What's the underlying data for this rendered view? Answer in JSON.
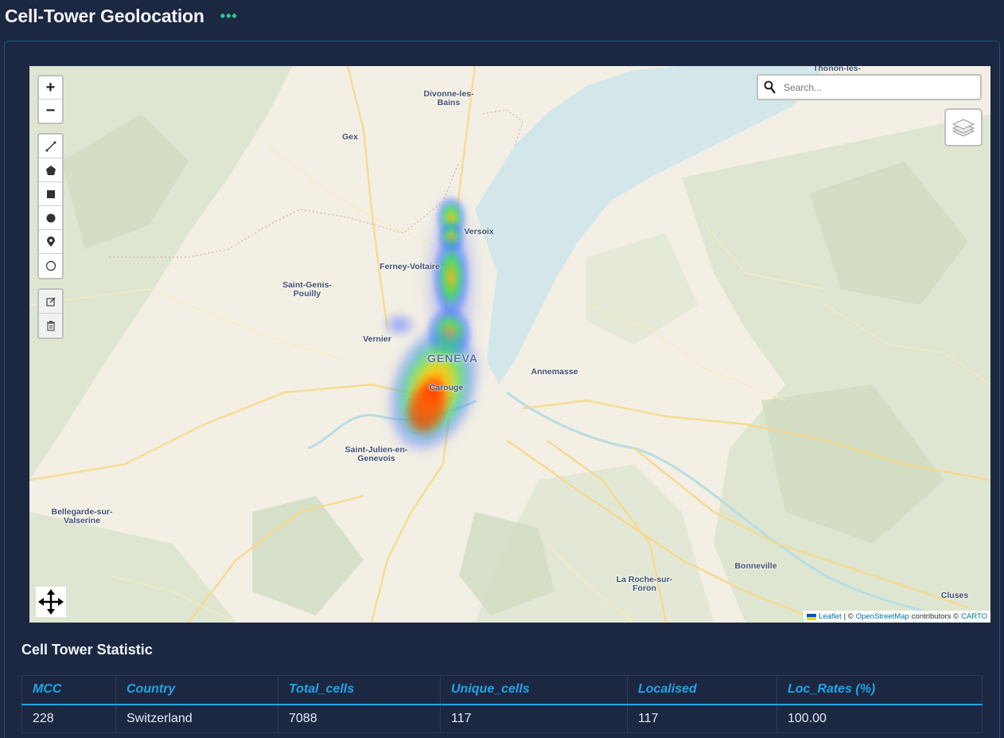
{
  "header": {
    "title": "Cell-Tower Geolocation",
    "menu_icon": "more-dots-icon"
  },
  "colors": {
    "background": "#1c2742",
    "accent": "#1fa6e6",
    "menu_dots": "#2ec98a"
  },
  "map": {
    "search_placeholder": "Search...",
    "zoom_in": "+",
    "zoom_out": "−",
    "draw_tools": [
      "polyline-icon",
      "polygon-icon",
      "rectangle-icon",
      "circle-icon",
      "marker-icon",
      "circlemarker-icon"
    ],
    "edit_tools": [
      "edit-icon",
      "trash-icon"
    ],
    "labels": [
      "Thonon-les-\nBains",
      "Divonne-les-\nBains",
      "Gex",
      "Versoix",
      "Ferney-Voltaire",
      "Saint-Genis-\nPouilly",
      "Vernier",
      "GENEVA",
      "Carouge",
      "Annemasse",
      "Saint-Julien-en-\nGenevois",
      "Bellegarde-sur-\nValserine",
      "Bonneville",
      "La Roche-sur-\nForon",
      "Cluses"
    ],
    "attribution": {
      "leaflet": "Leaflet",
      "sep": " | © ",
      "osm": "OpenStreetMap",
      "contrib": " contributors © ",
      "carto": "CARTO"
    }
  },
  "stats": {
    "title": "Cell Tower Statistic",
    "columns": [
      "MCC",
      "Country",
      "Total_cells",
      "Unique_cells",
      "Localised",
      "Loc_Rates (%)"
    ],
    "rows": [
      [
        "228",
        "Switzerland",
        "7088",
        "117",
        "117",
        "100.00"
      ]
    ]
  }
}
